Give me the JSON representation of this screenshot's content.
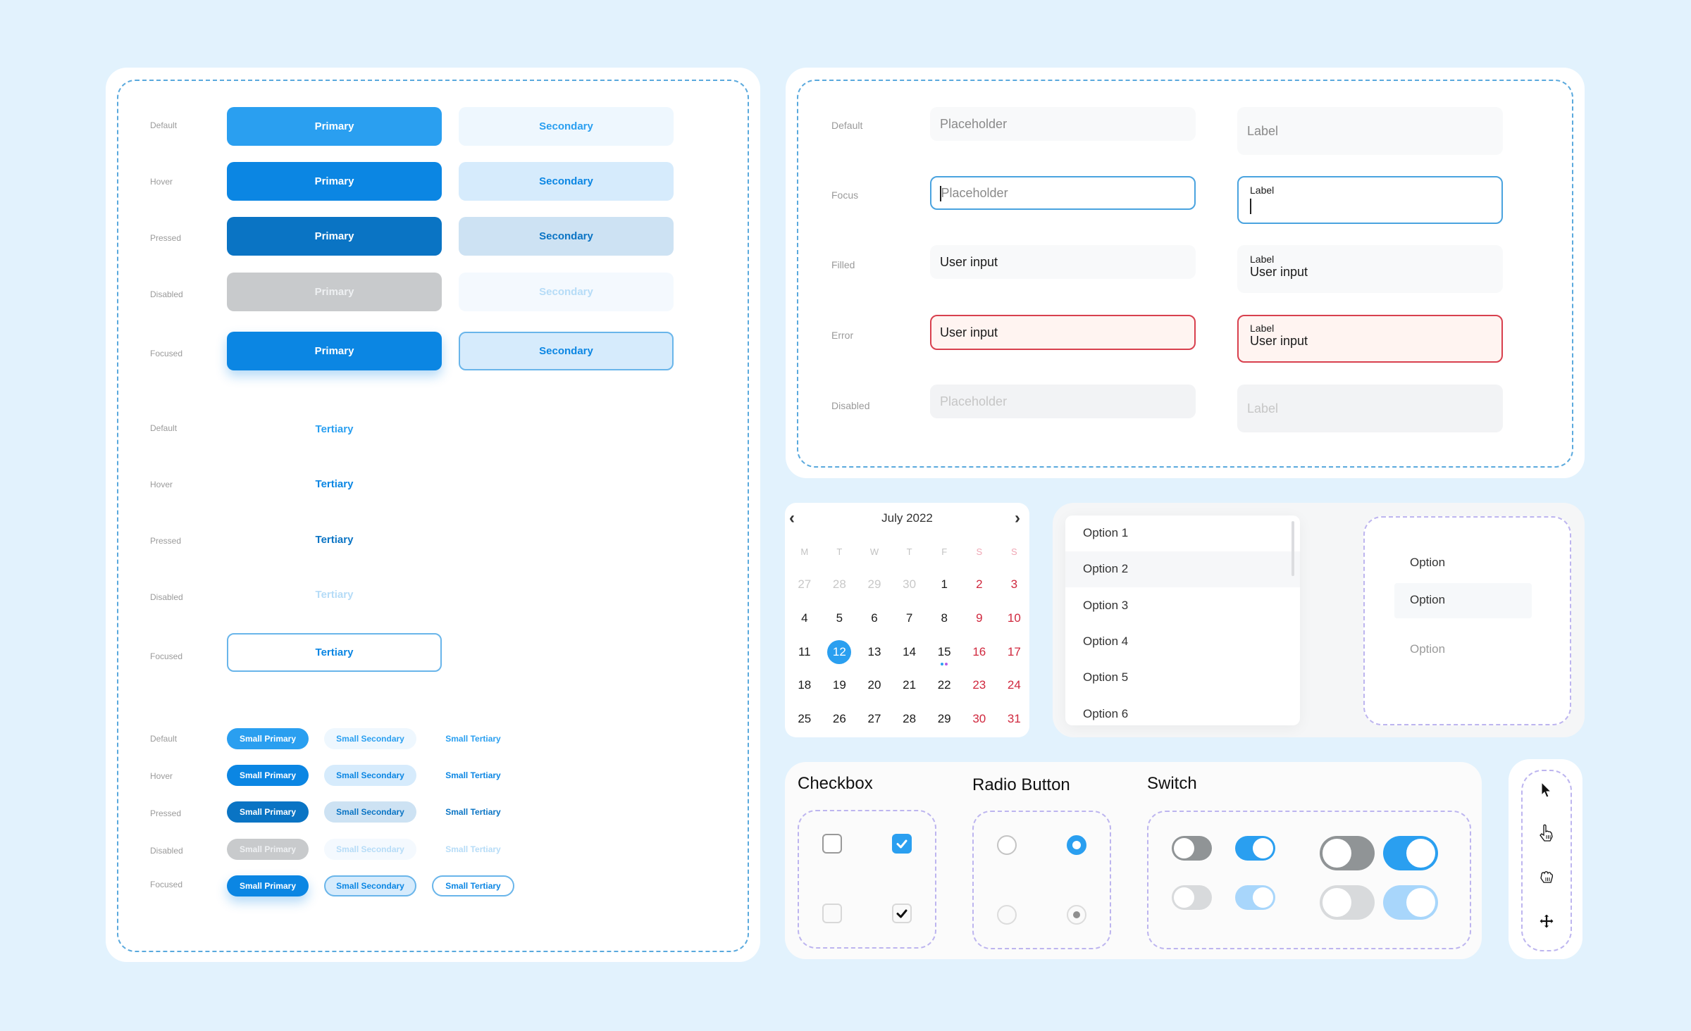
{
  "colors": {
    "background": "#e2f2fd",
    "primary": "#2a9ff0",
    "primary_hover": "#0b86e3",
    "primary_pressed": "#0a74c4",
    "disabled_gray": "#c8cacc",
    "error": "#d8404e",
    "weekend_red": "#d0283e",
    "guide_blue": "#5aa9dd",
    "guide_purple": "#bdb5ef"
  },
  "buttons": {
    "states": [
      "Default",
      "Hover",
      "Pressed",
      "Disabled",
      "Focused"
    ],
    "primary_label": "Primary",
    "secondary_label": "Secondary",
    "tertiary_label": "Tertiary",
    "small_primary_label": "Small Primary",
    "small_secondary_label": "Small Secondary",
    "small_tertiary_label": "Small Tertiary"
  },
  "inputs": {
    "states": [
      "Default",
      "Focus",
      "Filled",
      "Error",
      "Disabled"
    ],
    "placeholder": "Placeholder",
    "label": "Label",
    "user_input": "User input"
  },
  "calendar": {
    "title": "July 2022",
    "prev_icon": "chevron-left-icon",
    "next_icon": "chevron-right-icon",
    "weekdays": [
      "M",
      "T",
      "W",
      "T",
      "F",
      "S",
      "S"
    ],
    "weeks": [
      [
        "27",
        "28",
        "29",
        "30",
        "1",
        "2",
        "3"
      ],
      [
        "4",
        "5",
        "6",
        "7",
        "8",
        "9",
        "10"
      ],
      [
        "11",
        "12",
        "13",
        "14",
        "15",
        "16",
        "17"
      ],
      [
        "18",
        "19",
        "20",
        "21",
        "22",
        "23",
        "24"
      ],
      [
        "25",
        "26",
        "27",
        "28",
        "29",
        "30",
        "31"
      ]
    ],
    "muted_days_first_week": 4,
    "selected_day": "12",
    "event_day": "15",
    "event_dot_colors": [
      "#2a9ff0",
      "#b45ee8"
    ]
  },
  "dropdown": {
    "options": [
      "Option 1",
      "Option 2",
      "Option 3",
      "Option 4",
      "Option 5",
      "Option 6"
    ],
    "hovered_index": 1
  },
  "option_states": {
    "items": [
      "Option",
      "Option",
      "Option"
    ],
    "states": [
      "default",
      "hover",
      "disabled"
    ]
  },
  "controls": {
    "checkbox_title": "Checkbox",
    "radio_title": "Radio Button",
    "switch_title": "Switch",
    "checkboxes": [
      {
        "checked": false,
        "disabled": false
      },
      {
        "checked": true,
        "disabled": false
      },
      {
        "checked": false,
        "disabled": true
      },
      {
        "checked": true,
        "disabled": true
      }
    ],
    "radios": [
      {
        "selected": false,
        "disabled": false
      },
      {
        "selected": true,
        "disabled": false
      },
      {
        "selected": false,
        "disabled": true
      },
      {
        "selected": true,
        "disabled": true
      }
    ],
    "switches": [
      {
        "size": "small",
        "on": false,
        "disabled": false
      },
      {
        "size": "small",
        "on": true,
        "disabled": false
      },
      {
        "size": "large",
        "on": false,
        "disabled": false
      },
      {
        "size": "large",
        "on": true,
        "disabled": false
      },
      {
        "size": "small",
        "on": false,
        "disabled": true
      },
      {
        "size": "small",
        "on": true,
        "disabled": true
      },
      {
        "size": "large",
        "on": false,
        "disabled": true
      },
      {
        "size": "large",
        "on": true,
        "disabled": true
      }
    ]
  },
  "cursors": [
    "arrow-cursor-icon",
    "pointer-hand-cursor-icon",
    "grab-hand-cursor-icon",
    "move-cursor-icon"
  ]
}
